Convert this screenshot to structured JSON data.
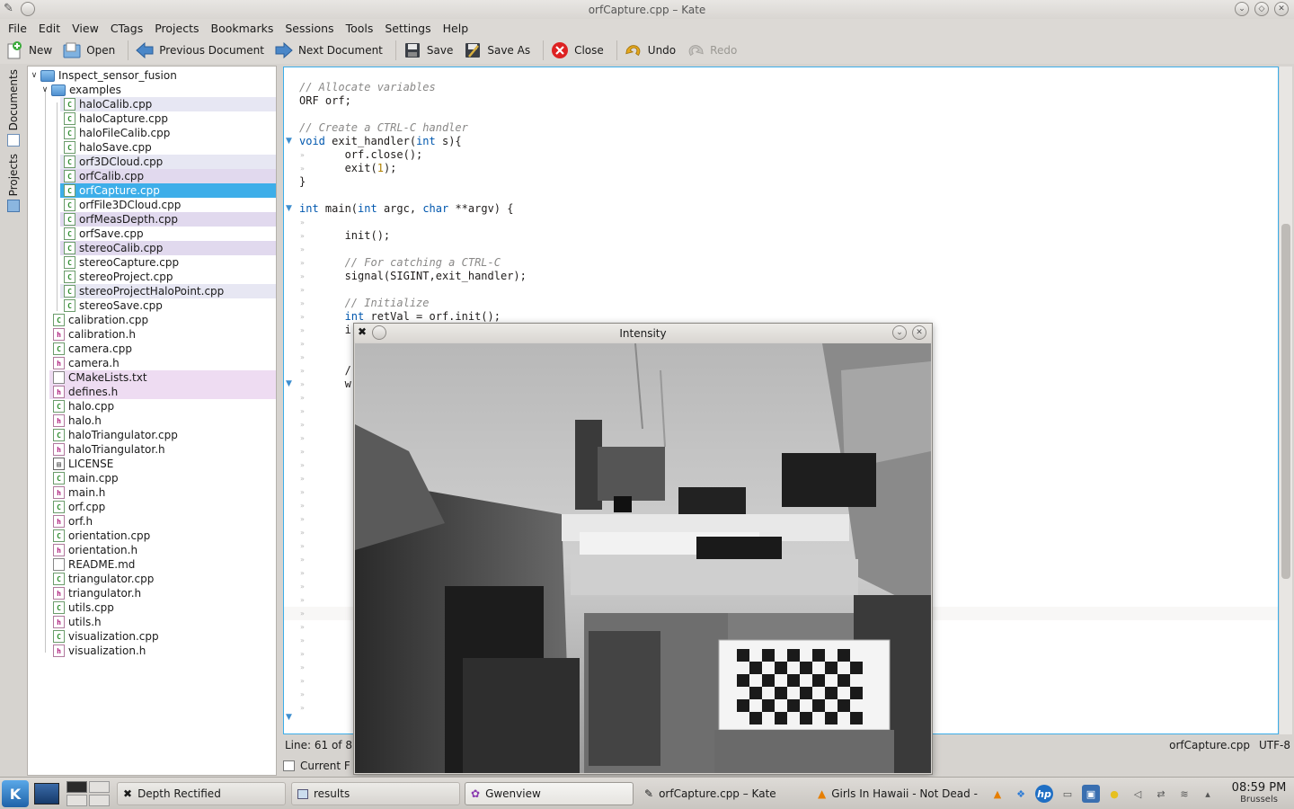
{
  "window": {
    "title": "orfCapture.cpp – Kate"
  },
  "menu": [
    "File",
    "Edit",
    "View",
    "CTags",
    "Projects",
    "Bookmarks",
    "Sessions",
    "Tools",
    "Settings",
    "Help"
  ],
  "toolbar": {
    "new": "New",
    "open": "Open",
    "previous": "Previous Document",
    "next": "Next Document",
    "save": "Save",
    "save_as": "Save As",
    "close": "Close",
    "undo": "Undo",
    "redo": "Redo"
  },
  "side_tabs": {
    "documents": "Documents",
    "projects": "Projects"
  },
  "tree": {
    "root": "Inspect_sensor_fusion",
    "folder": "examples",
    "examples": [
      {
        "name": "haloCalib.cpp",
        "type": "cpp",
        "hl": "hl1"
      },
      {
        "name": "haloCapture.cpp",
        "type": "cpp",
        "hl": ""
      },
      {
        "name": "haloFileCalib.cpp",
        "type": "cpp",
        "hl": ""
      },
      {
        "name": "haloSave.cpp",
        "type": "cpp",
        "hl": ""
      },
      {
        "name": "orf3DCloud.cpp",
        "type": "cpp",
        "hl": "hl1"
      },
      {
        "name": "orfCalib.cpp",
        "type": "cpp",
        "hl": "hl2"
      },
      {
        "name": "orfCapture.cpp",
        "type": "cpp",
        "hl": "sel"
      },
      {
        "name": "orfFile3DCloud.cpp",
        "type": "cpp",
        "hl": ""
      },
      {
        "name": "orfMeasDepth.cpp",
        "type": "cpp",
        "hl": "hl2"
      },
      {
        "name": "orfSave.cpp",
        "type": "cpp",
        "hl": ""
      },
      {
        "name": "stereoCalib.cpp",
        "type": "cpp",
        "hl": "hl2"
      },
      {
        "name": "stereoCapture.cpp",
        "type": "cpp",
        "hl": ""
      },
      {
        "name": "stereoProject.cpp",
        "type": "cpp",
        "hl": ""
      },
      {
        "name": "stereoProjectHaloPoint.cpp",
        "type": "cpp",
        "hl": "hl1"
      },
      {
        "name": "stereoSave.cpp",
        "type": "cpp",
        "hl": ""
      }
    ],
    "files": [
      {
        "name": "calibration.cpp",
        "type": "cpp",
        "hl": ""
      },
      {
        "name": "calibration.h",
        "type": "h",
        "hl": ""
      },
      {
        "name": "camera.cpp",
        "type": "cpp",
        "hl": ""
      },
      {
        "name": "camera.h",
        "type": "h",
        "hl": ""
      },
      {
        "name": "CMakeLists.txt",
        "type": "txt",
        "hl": "hl3"
      },
      {
        "name": "defines.h",
        "type": "h",
        "hl": "hl3"
      },
      {
        "name": "halo.cpp",
        "type": "cpp",
        "hl": ""
      },
      {
        "name": "halo.h",
        "type": "h",
        "hl": ""
      },
      {
        "name": "haloTriangulator.cpp",
        "type": "cpp",
        "hl": ""
      },
      {
        "name": "haloTriangulator.h",
        "type": "h",
        "hl": ""
      },
      {
        "name": "LICENSE",
        "type": "lic",
        "hl": ""
      },
      {
        "name": "main.cpp",
        "type": "cpp",
        "hl": ""
      },
      {
        "name": "main.h",
        "type": "h",
        "hl": ""
      },
      {
        "name": "orf.cpp",
        "type": "cpp",
        "hl": ""
      },
      {
        "name": "orf.h",
        "type": "h",
        "hl": ""
      },
      {
        "name": "orientation.cpp",
        "type": "cpp",
        "hl": ""
      },
      {
        "name": "orientation.h",
        "type": "h",
        "hl": ""
      },
      {
        "name": "README.md",
        "type": "txt",
        "hl": ""
      },
      {
        "name": "triangulator.cpp",
        "type": "cpp",
        "hl": ""
      },
      {
        "name": "triangulator.h",
        "type": "h",
        "hl": ""
      },
      {
        "name": "utils.cpp",
        "type": "cpp",
        "hl": ""
      },
      {
        "name": "utils.h",
        "type": "h",
        "hl": ""
      },
      {
        "name": "visualization.cpp",
        "type": "cpp",
        "hl": ""
      },
      {
        "name": "visualization.h",
        "type": "h",
        "hl": ""
      }
    ]
  },
  "code": [
    {
      "text": "// Allocate variables",
      "kind": "com"
    },
    {
      "text": "ORF orf;",
      "kind": "plain"
    },
    {
      "text": "",
      "kind": "plain"
    },
    {
      "text": "// Create a CTRL-C handler",
      "kind": "com"
    },
    {
      "html_parts": [
        [
          "kw",
          "void"
        ],
        [
          "p",
          " exit_handler("
        ],
        [
          "kw",
          "int"
        ],
        [
          "p",
          " s){"
        ]
      ],
      "fold": true
    },
    {
      "html_parts": [
        [
          "p",
          "       orf.close();"
        ]
      ],
      "dot": true
    },
    {
      "html_parts": [
        [
          "p",
          "       exit("
        ],
        [
          "num",
          "1"
        ],
        [
          "p",
          ");"
        ]
      ],
      "dot": true
    },
    {
      "text": "}",
      "kind": "plain"
    },
    {
      "text": "",
      "kind": "plain"
    },
    {
      "html_parts": [
        [
          "kw",
          "int"
        ],
        [
          "p",
          " main("
        ],
        [
          "kw",
          "int"
        ],
        [
          "p",
          " argc, "
        ],
        [
          "kw",
          "char"
        ],
        [
          "p",
          " **argv) {"
        ]
      ],
      "fold": true
    },
    {
      "text": "",
      "kind": "plain",
      "dot": true
    },
    {
      "html_parts": [
        [
          "p",
          "       init();"
        ]
      ],
      "dot": true
    },
    {
      "text": "",
      "kind": "plain",
      "dot": true
    },
    {
      "html_parts": [
        [
          "com",
          "       // For catching a CTRL-C"
        ]
      ],
      "dot": true
    },
    {
      "html_parts": [
        [
          "p",
          "       signal(SIGINT,exit_handler);"
        ]
      ],
      "dot": true
    },
    {
      "text": "",
      "kind": "plain",
      "dot": true
    },
    {
      "html_parts": [
        [
          "com",
          "       // Initialize"
        ]
      ],
      "dot": true
    },
    {
      "html_parts": [
        [
          "kw",
          "       int"
        ],
        [
          "p",
          " retVal = orf.init();"
        ]
      ],
      "dot": true
    },
    {
      "html_parts": [
        [
          "p",
          "       i"
        ]
      ],
      "dot": true
    },
    {
      "text": "",
      "kind": "plain",
      "dot": true
    },
    {
      "text": "",
      "kind": "plain",
      "dot": true
    },
    {
      "html_parts": [
        [
          "p",
          "       /"
        ]
      ],
      "dot": true
    },
    {
      "html_parts": [
        [
          "p",
          "       w"
        ]
      ],
      "dot": true,
      "fold": true
    }
  ],
  "status": {
    "line": "Line: 61 of 87",
    "file": "orfCapture.cpp",
    "encoding": "UTF-8",
    "bottom_tab": "Current F"
  },
  "image_window": {
    "title": "Intensity"
  },
  "taskbar": {
    "tasks": [
      "Depth Rectified",
      "results",
      "Gwenview",
      "orfCapture.cpp – Kate",
      "Girls In Hawaii - Not Dead - V"
    ],
    "clock": "08:59 PM",
    "city": "Brussels"
  },
  "colors": {
    "selection": "#3daee9",
    "keyword": "#0057ae",
    "comment": "#898887"
  }
}
